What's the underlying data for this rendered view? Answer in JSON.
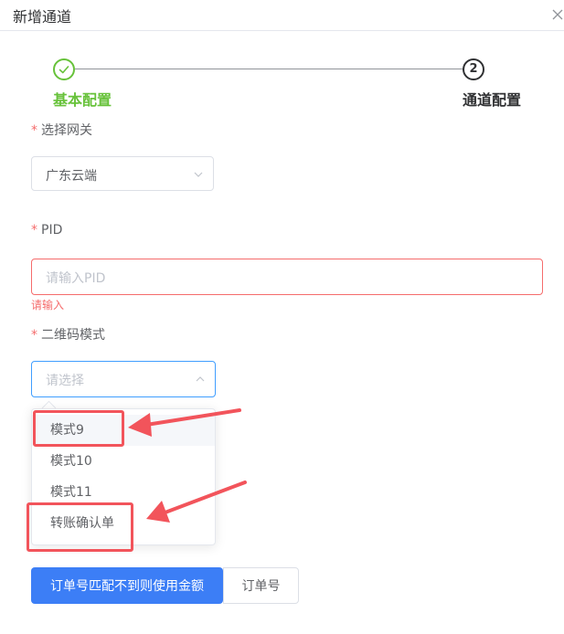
{
  "dialog": {
    "title": "新增通道"
  },
  "steps": [
    {
      "label": "基本配置",
      "status": "finished",
      "icon": "check-icon"
    },
    {
      "label": "通道配置",
      "number": "2",
      "status": "current"
    }
  ],
  "form": {
    "required_mark": "*",
    "gateway": {
      "label": "选择网关",
      "value": "广东云端"
    },
    "pid": {
      "label": "PID",
      "placeholder": "请输入PID",
      "error": "请输入"
    },
    "qr_mode": {
      "label": "二维码模式",
      "placeholder": "请选择",
      "options": [
        "模式9",
        "模式10",
        "模式11",
        "转账确认单"
      ]
    }
  },
  "buttons": {
    "primary": "订单号匹配不到则使用金额",
    "secondary": "订单号"
  },
  "colors": {
    "success": "#67c23a",
    "error": "#f56c6c",
    "focus": "#409eff",
    "primary_button": "#3c7ef6",
    "annotation": "#f2545b"
  }
}
